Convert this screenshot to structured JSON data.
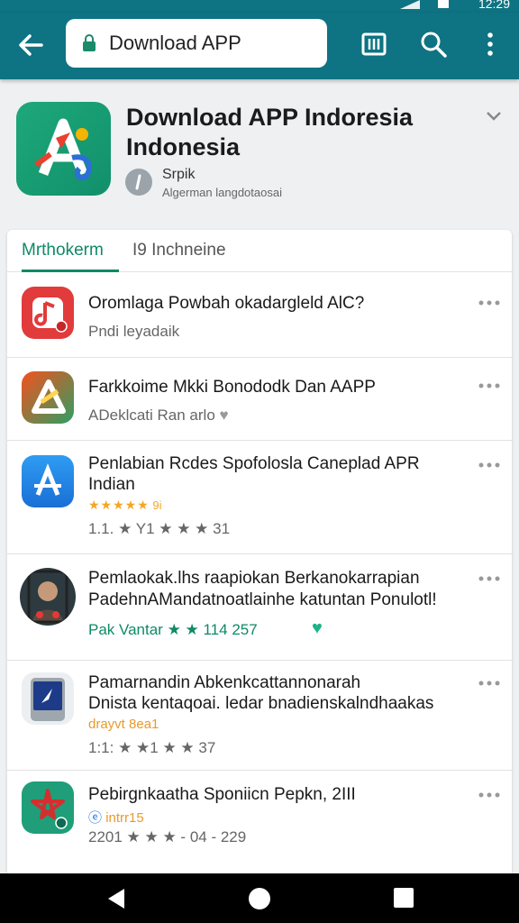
{
  "status": {
    "time": "12:29"
  },
  "appbar": {
    "search_value": "Download APP",
    "icons": [
      "back-arrow-icon",
      "lock-icon",
      "grid-icon",
      "search-icon",
      "more-vert-icon"
    ]
  },
  "app": {
    "title_line1": "Download APP Indoresia",
    "title_line2": "Indonesia",
    "dev_name": "Srpik",
    "dev_sub": "Algerman langdotaosai"
  },
  "tabs": {
    "active": "Mrthokerm",
    "other": "I9 Inchneine"
  },
  "items": [
    {
      "title": "Oromlaga Powbah okadargleld AlC?",
      "sub": "Pndi leyadaik"
    },
    {
      "title": "Farkkoime Mkki Bonododk Dan AAPP",
      "sub": "ADeklcati Ran arlo"
    },
    {
      "title": "Penlabian Rcdes Spofolosla Caneplad APR",
      "title2": "Indian",
      "stars": "★★★★★",
      "rating_note": "9i",
      "meta": "1.1. ★ Y1 ★ ★ ★ 31"
    },
    {
      "title": "Pemlaokak.lhs raapiokan Berkanokarrapian",
      "title2": "PadehnAMandatnoatlainhe katuntan Ponulotl!",
      "meta": "Pak Vantar ★ ★ 114 257"
    },
    {
      "title": "Pamarnandin Abkenkcattannonarah",
      "title2": "Dnista kentaqoai. ledar bnadienskalndhaakas",
      "sub2": "drayvt 8ea1",
      "meta": "1:1: ★ ★1 ★ ★ 37"
    },
    {
      "title": "Pebirgnkaatha Sponiicn Pepkn, 2III",
      "sub2": "intrr15",
      "meta": "2201 ★ ★ ★ - 04 - 229"
    }
  ],
  "colors": {
    "appbar": "#0e7382",
    "accent": "#0f8a66",
    "star": "#f5a623"
  }
}
